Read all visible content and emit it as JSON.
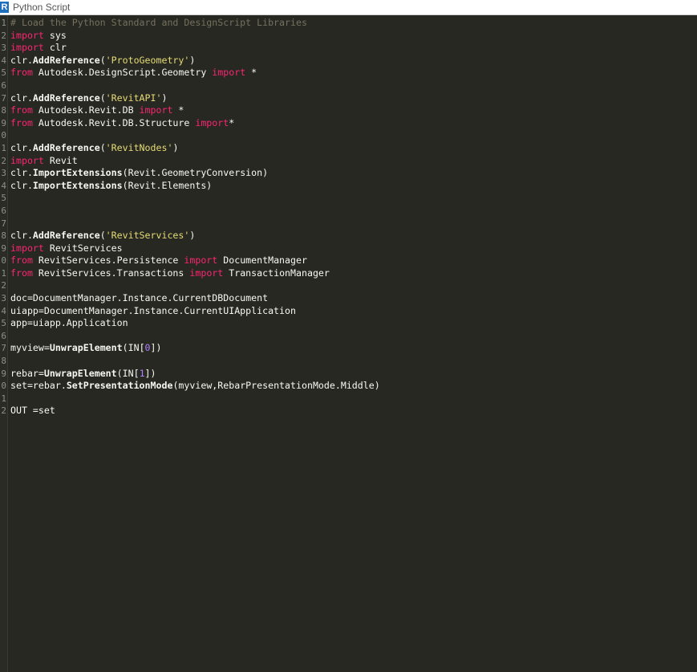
{
  "window": {
    "title": "Python Script",
    "icon_glyph": "R",
    "icon_name": "revit-r-icon"
  },
  "gutter": {
    "numbers": [
      "1",
      "2",
      "3",
      "4",
      "5",
      "6",
      "7",
      "8",
      "9",
      "0",
      "1",
      "2",
      "3",
      "4",
      "5",
      "6",
      "7",
      "8",
      "9",
      "0",
      "1",
      "2",
      "3",
      "4",
      "5",
      "6",
      "7",
      "8",
      "9",
      "0",
      "1",
      "2"
    ]
  },
  "lines": [
    [
      {
        "t": "# Load the Python Standard and DesignScript Libraries",
        "c": "cm"
      }
    ],
    [
      {
        "t": "import",
        "c": "kw"
      },
      {
        "t": " sys",
        "c": ""
      }
    ],
    [
      {
        "t": "import",
        "c": "kw"
      },
      {
        "t": " clr",
        "c": ""
      }
    ],
    [
      {
        "t": "clr.",
        "c": ""
      },
      {
        "t": "AddReference",
        "c": "fn"
      },
      {
        "t": "(",
        "c": ""
      },
      {
        "t": "'ProtoGeometry'",
        "c": "st"
      },
      {
        "t": ")",
        "c": ""
      }
    ],
    [
      {
        "t": "from",
        "c": "kw"
      },
      {
        "t": " Autodesk.DesignScript.Geometry ",
        "c": ""
      },
      {
        "t": "import",
        "c": "kw"
      },
      {
        "t": " *",
        "c": ""
      }
    ],
    [],
    [
      {
        "t": "clr.",
        "c": ""
      },
      {
        "t": "AddReference",
        "c": "fn"
      },
      {
        "t": "(",
        "c": ""
      },
      {
        "t": "'RevitAPI'",
        "c": "st"
      },
      {
        "t": ")",
        "c": ""
      }
    ],
    [
      {
        "t": "from",
        "c": "kw"
      },
      {
        "t": " Autodesk.Revit.DB ",
        "c": ""
      },
      {
        "t": "import",
        "c": "kw"
      },
      {
        "t": " *",
        "c": ""
      }
    ],
    [
      {
        "t": "from",
        "c": "kw"
      },
      {
        "t": " Autodesk.Revit.DB.Structure ",
        "c": ""
      },
      {
        "t": "import",
        "c": "kw"
      },
      {
        "t": "*",
        "c": ""
      }
    ],
    [],
    [
      {
        "t": "clr.",
        "c": ""
      },
      {
        "t": "AddReference",
        "c": "fn"
      },
      {
        "t": "(",
        "c": ""
      },
      {
        "t": "'RevitNodes'",
        "c": "st"
      },
      {
        "t": ")",
        "c": ""
      }
    ],
    [
      {
        "t": "import",
        "c": "kw"
      },
      {
        "t": " Revit",
        "c": ""
      }
    ],
    [
      {
        "t": "clr.",
        "c": ""
      },
      {
        "t": "ImportExtensions",
        "c": "fn"
      },
      {
        "t": "(Revit.GeometryConversion)",
        "c": ""
      }
    ],
    [
      {
        "t": "clr.",
        "c": ""
      },
      {
        "t": "ImportExtensions",
        "c": "fn"
      },
      {
        "t": "(Revit.Elements)",
        "c": ""
      }
    ],
    [],
    [],
    [],
    [
      {
        "t": "clr.",
        "c": ""
      },
      {
        "t": "AddReference",
        "c": "fn"
      },
      {
        "t": "(",
        "c": ""
      },
      {
        "t": "'RevitServices'",
        "c": "st"
      },
      {
        "t": ")",
        "c": ""
      }
    ],
    [
      {
        "t": "import",
        "c": "kw"
      },
      {
        "t": " RevitServices",
        "c": ""
      }
    ],
    [
      {
        "t": "from",
        "c": "kw"
      },
      {
        "t": " RevitServices.Persistence ",
        "c": ""
      },
      {
        "t": "import",
        "c": "kw"
      },
      {
        "t": " DocumentManager",
        "c": ""
      }
    ],
    [
      {
        "t": "from",
        "c": "kw"
      },
      {
        "t": " RevitServices.Transactions ",
        "c": ""
      },
      {
        "t": "import",
        "c": "kw"
      },
      {
        "t": " TransactionManager",
        "c": ""
      }
    ],
    [],
    [
      {
        "t": "doc=DocumentManager.Instance.CurrentDBDocument",
        "c": ""
      }
    ],
    [
      {
        "t": "uiapp=DocumentManager.Instance.CurrentUIApplication",
        "c": ""
      }
    ],
    [
      {
        "t": "app=uiapp.Application",
        "c": ""
      }
    ],
    [],
    [
      {
        "t": "myview=",
        "c": ""
      },
      {
        "t": "UnwrapElement",
        "c": "fn"
      },
      {
        "t": "(IN[",
        "c": ""
      },
      {
        "t": "0",
        "c": "nm"
      },
      {
        "t": "])",
        "c": ""
      }
    ],
    [],
    [
      {
        "t": "rebar=",
        "c": ""
      },
      {
        "t": "UnwrapElement",
        "c": "fn"
      },
      {
        "t": "(IN[",
        "c": ""
      },
      {
        "t": "1",
        "c": "nm"
      },
      {
        "t": "])",
        "c": ""
      }
    ],
    [
      {
        "t": "set=rebar.",
        "c": ""
      },
      {
        "t": "SetPresentationMode",
        "c": "fn"
      },
      {
        "t": "(myview,RebarPresentationMode.Middle)",
        "c": ""
      }
    ],
    [],
    [
      {
        "t": "OUT =set",
        "c": ""
      }
    ]
  ]
}
